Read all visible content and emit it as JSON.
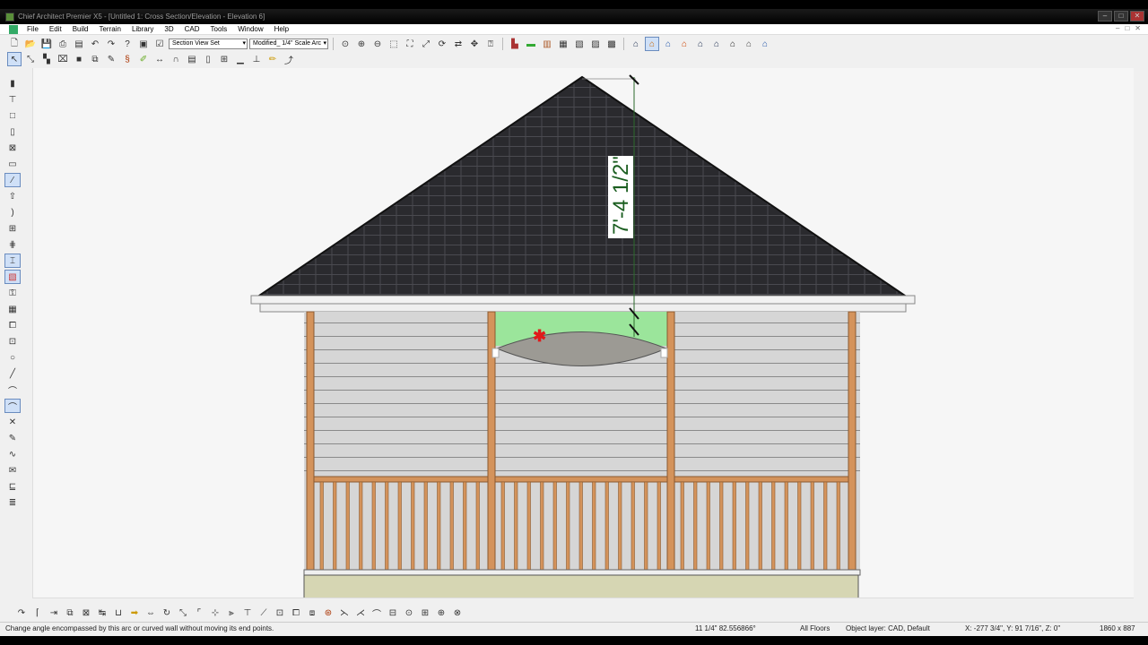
{
  "window": {
    "title": "Chief Architect Premier X5 - [Untitled 1: Cross Section/Elevation - Elevation 6]",
    "controls": [
      "–",
      "□",
      "✕"
    ]
  },
  "menu": {
    "items": [
      "File",
      "Edit",
      "Build",
      "Terrain",
      "Library",
      "3D",
      "CAD",
      "Tools",
      "Window",
      "Help"
    ],
    "mdi_controls": [
      "–",
      "□",
      "✕"
    ]
  },
  "toolbar": {
    "view_set": "Section View Set",
    "layer_set": "Modified_ 1/4\" Scale Arc"
  },
  "drawing": {
    "dimension_label": "7'-4 1/2\"",
    "colors": {
      "roof": "#2a2a2e",
      "siding": "#d6d6d6",
      "post": "#d4935b",
      "selected_fill": "#9be59b",
      "arc_fill": "#9c9a94",
      "foundation": "#d6d6b3"
    }
  },
  "status": {
    "hint": "Change angle encompassed by this arc or curved wall without moving its end points.",
    "measure": "11 1/4\"    82.556866°",
    "floors": "All Floors",
    "layer": "Object layer: CAD,  Default",
    "coords": "X: -277 3/4\", Y: 91 7/16\", Z: 0\"",
    "size": "1860 x 887"
  }
}
